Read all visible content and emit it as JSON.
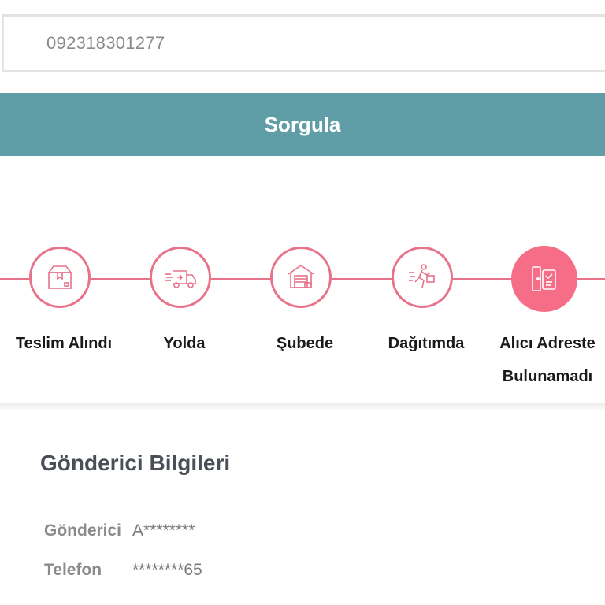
{
  "search": {
    "value": "092318301277"
  },
  "query_button": {
    "label": "Sorgula"
  },
  "colors": {
    "button": "#5f9ea6",
    "accent": "#e8728a",
    "active_step": "#f56d87"
  },
  "steps": [
    {
      "label": "Teslim Alındı",
      "icon": "package-box-icon",
      "state": "done"
    },
    {
      "label": "Yolda",
      "icon": "delivery-truck-icon",
      "state": "done"
    },
    {
      "label": "Şubede",
      "icon": "warehouse-icon",
      "state": "done"
    },
    {
      "label": "Dağıtımda",
      "icon": "courier-running-icon",
      "state": "done"
    },
    {
      "label_line1": "Alıcı Adreste",
      "label_line2": "Bulunamadı",
      "icon": "phone-door-icon",
      "state": "active"
    }
  ],
  "sender_section": {
    "title": "Gönderici Bilgileri",
    "rows": [
      {
        "key": "Gönderici",
        "value": "A********"
      },
      {
        "key": "Telefon",
        "value": "********65"
      }
    ]
  }
}
